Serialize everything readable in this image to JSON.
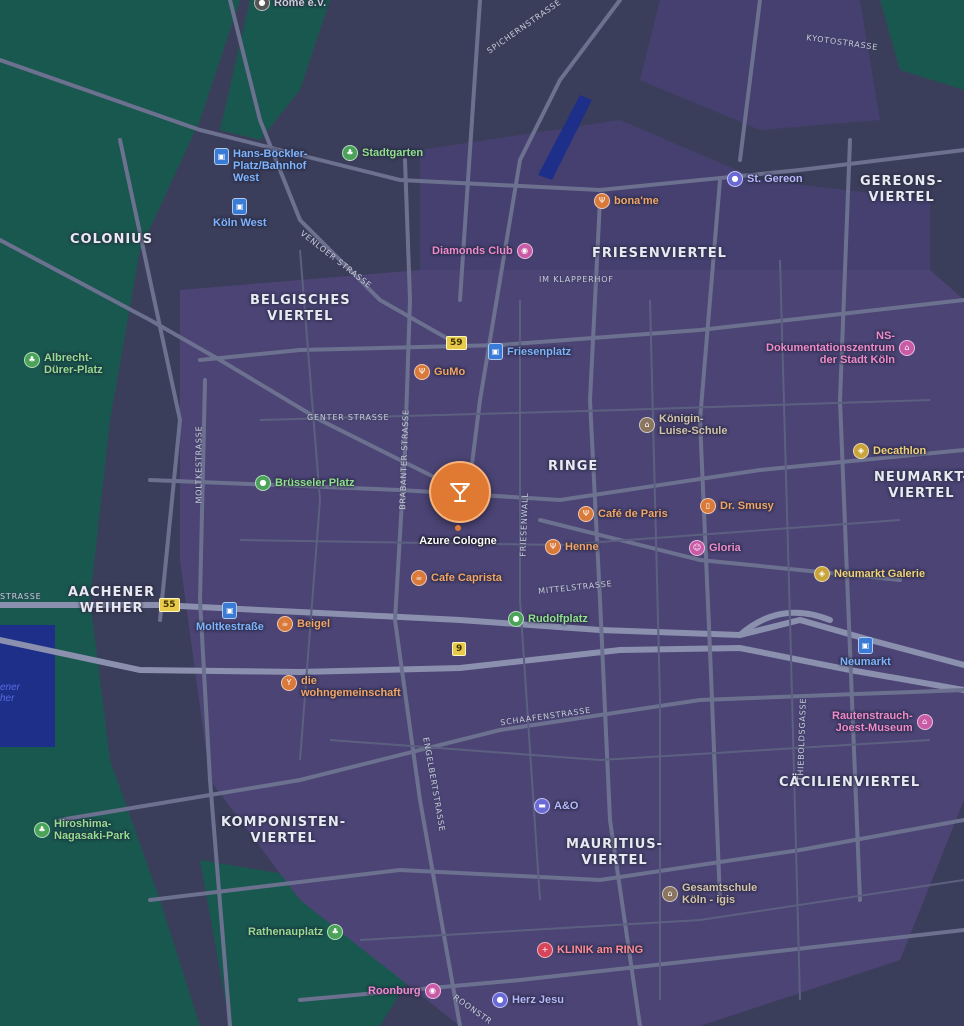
{
  "colors": {
    "land": "#3b3e5a",
    "district": "#4b4475",
    "park": "#19584f",
    "road": "#6d7190",
    "major_road": "#8b90ae",
    "water": "#1e2f8a",
    "accent": "#e07a32"
  },
  "selected": {
    "name": "Azure Cologne",
    "icon": "cocktail-glass-icon"
  },
  "districts": {
    "colonius": "COLONIUS",
    "belgisches": [
      "BELGISCHES",
      "VIERTEL"
    ],
    "friesenviertel": "FRIESENVIERTEL",
    "gereons": [
      "GEREONS-",
      "VIERTEL"
    ],
    "ringe": "RINGE",
    "neumarkt": [
      "NEUMARKT-",
      "VIERTEL"
    ],
    "aachener": [
      "AACHENER",
      "WEIHER"
    ],
    "komponisten": [
      "KOMPONISTEN-",
      "VIERTEL"
    ],
    "mauritius": [
      "MAURITIUS-",
      "VIERTEL"
    ],
    "caecilien": "CÄCILIENVIERTEL"
  },
  "streets": {
    "spichern": "SPICHERNSTRASSE",
    "kyoto": "KYOTOSTRASSE",
    "venloer": "VENLOER STRASSE",
    "klapperhof": "IM KLAPPERHOF",
    "genter": "GENTER STRASSE",
    "moltke": "MOLTKESTRASSE",
    "brabanter": "BRABANTER STRASSE",
    "friesenwall": "FRIESENWALL",
    "mittel": "MITTELSTRASSE",
    "aachener": "STRASSE",
    "schaafen": "SCHAAFENSTRASSE",
    "engelbert": "ENGELBERTSTRASSE",
    "thieboldsgasse": "THIEBOLDSGASSE",
    "roonstr": "ROONSTR"
  },
  "shields": {
    "s59": "59",
    "s55": "55",
    "s9": "9"
  },
  "water_label": [
    "ener",
    "her"
  ],
  "pois": {
    "rome": {
      "label": "Rome e.V.",
      "icon": "place-icon"
    },
    "hans_boeckler": {
      "label": [
        "Hans-Böckler-",
        "Platz/Bahnhof",
        "West"
      ],
      "icon": "train-icon"
    },
    "koeln_west": {
      "label": "Köln West",
      "icon": "train-icon"
    },
    "stadtgarten": {
      "label": "Stadtgarten",
      "icon": "tree-icon"
    },
    "boname": {
      "label": "bona'me",
      "icon": "fork-knife-icon"
    },
    "st_gereon": {
      "label": "St. Gereon",
      "icon": "church-icon"
    },
    "diamonds": {
      "label": "Diamonds Club",
      "icon": "nightlife-icon"
    },
    "friesenplatz": {
      "label": "Friesenplatz",
      "icon": "train-icon"
    },
    "gumo": {
      "label": "GuMo",
      "icon": "fork-knife-icon"
    },
    "albrecht": {
      "label": [
        "Albrecht-",
        "Dürer-Platz"
      ],
      "icon": "tree-icon"
    },
    "ns_doku": {
      "label": [
        "NS-",
        "Dokumentationszentrum",
        "der Stadt Köln"
      ],
      "icon": "museum-icon"
    },
    "koenigin": {
      "label": [
        "Königin-",
        "Luise-Schule"
      ],
      "icon": "school-icon"
    },
    "decathlon": {
      "label": "Decathlon",
      "icon": "shopping-icon"
    },
    "bruesseler": {
      "label": "Brüsseler Platz",
      "icon": "park-dot-icon"
    },
    "dr_smusy": {
      "label": "Dr. Smusy",
      "icon": "drink-cup-icon"
    },
    "cafe_paris": {
      "label": "Café de Paris",
      "icon": "fork-knife-icon"
    },
    "henne": {
      "label": "Henne",
      "icon": "fork-knife-icon"
    },
    "gloria": {
      "label": "Gloria",
      "icon": "theater-icon"
    },
    "cafe_caprista": {
      "label": "Cafe Caprista",
      "icon": "coffee-icon"
    },
    "neumarkt_galerie": {
      "label": "Neumarkt Galerie",
      "icon": "shopping-icon"
    },
    "moltkestrasse": {
      "label": "Moltkestraße",
      "icon": "train-icon"
    },
    "beigel": {
      "label": "Beigel",
      "icon": "coffee-icon"
    },
    "rudolfplatz": {
      "label": "Rudolfplatz",
      "icon": "park-dot-icon"
    },
    "neumarkt": {
      "label": "Neumarkt",
      "icon": "train-icon"
    },
    "wohngemeinschaft": {
      "label": [
        "die",
        "wohngemeinschaft"
      ],
      "icon": "cocktail-glass-icon"
    },
    "rautenstrauch": {
      "label": [
        "Rautenstrauch-",
        "Joest-Museum"
      ],
      "icon": "museum-icon"
    },
    "ao": {
      "label": "A&O",
      "icon": "hotel-bed-icon"
    },
    "hiroshima": {
      "label": [
        "Hiroshima-",
        "Nagasaki-Park"
      ],
      "icon": "tree-icon"
    },
    "gesamtschule": {
      "label": [
        "Gesamtschule",
        "Köln - igis"
      ],
      "icon": "school-icon"
    },
    "rathenauplatz": {
      "label": "Rathenauplatz",
      "icon": "tree-icon"
    },
    "klinik": {
      "label": "KLINIK am RING",
      "icon": "hospital-cross-icon"
    },
    "roonburg": {
      "label": "Roonburg",
      "icon": "nightlife-icon"
    },
    "herz_jesu": {
      "label": "Herz Jesu",
      "icon": "church-icon"
    }
  }
}
